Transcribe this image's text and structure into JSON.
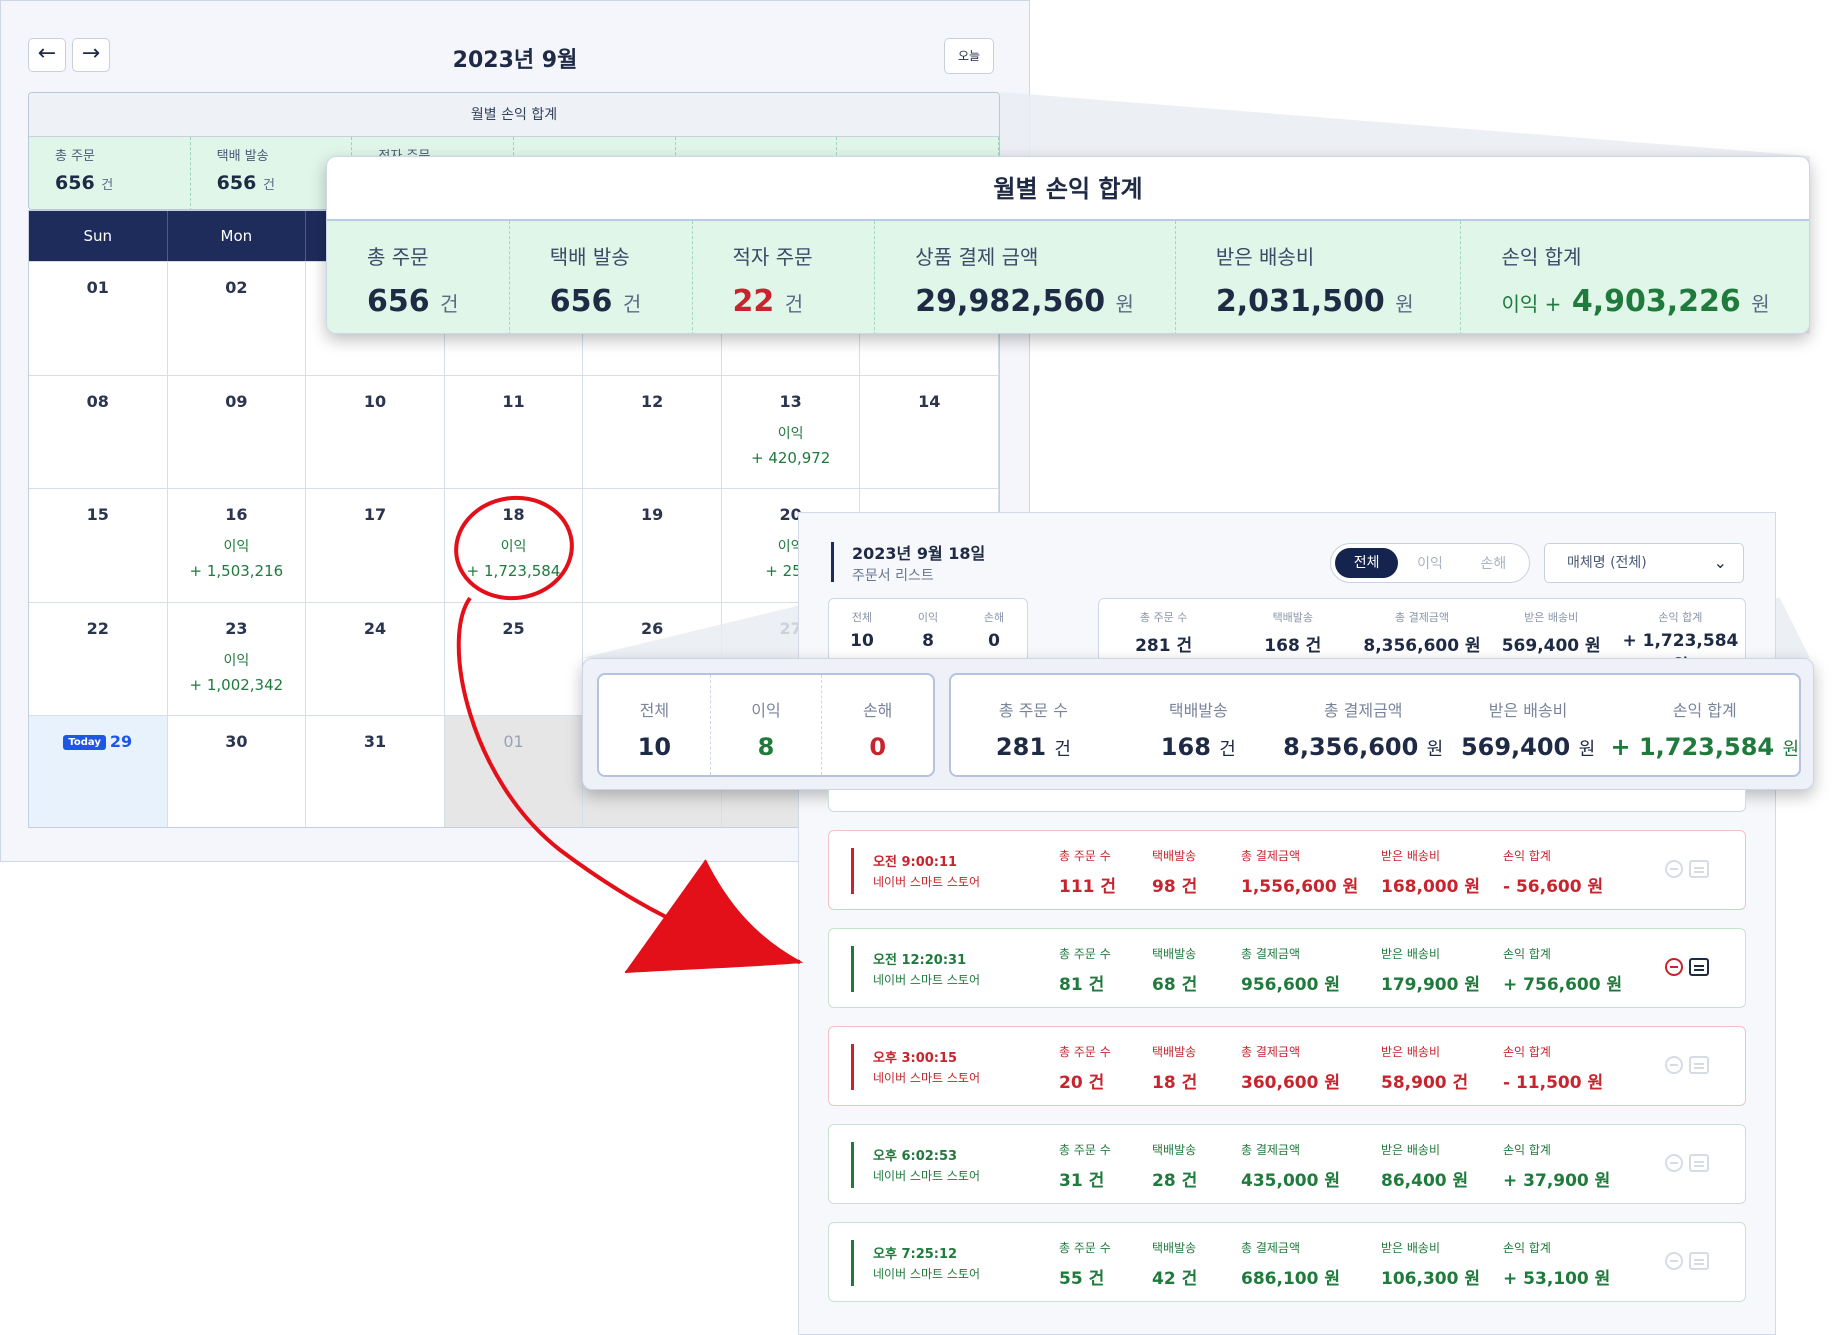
{
  "calendar": {
    "title": "2023년 9월",
    "prev_icon": "arrow-left-icon",
    "next_icon": "arrow-right-icon",
    "today_label": "오늘",
    "summary_title": "월별 손익 합계",
    "summary_preview": [
      {
        "label": "총 주문",
        "value": "656",
        "unit": "건"
      },
      {
        "label": "택배 발송",
        "value": "656",
        "unit": "건"
      },
      {
        "label": "적자 주문",
        "value": "22",
        "unit": ""
      },
      {
        "label": "",
        "value": "",
        "unit": ""
      },
      {
        "label": "",
        "value": "",
        "unit": ""
      },
      {
        "label": "",
        "value": "",
        "unit": ""
      }
    ],
    "weekdays": [
      "Sun",
      "Mon",
      "Tue",
      "Wed",
      "Thu",
      "Fri",
      "Sat"
    ],
    "today_badge": "Today",
    "weeks": [
      [
        {
          "d": "01",
          "l": "",
          "v": ""
        },
        {
          "d": "02",
          "l": "",
          "v": ""
        },
        {
          "d": "",
          "l": "",
          "v": ""
        },
        {
          "d": "",
          "l": "",
          "v": ""
        },
        {
          "d": "",
          "l": "",
          "v": ""
        },
        {
          "d": "",
          "l": "",
          "v": ""
        },
        {
          "d": "",
          "l": "",
          "v": ""
        }
      ],
      [
        {
          "d": "08",
          "l": "",
          "v": ""
        },
        {
          "d": "09",
          "l": "",
          "v": ""
        },
        {
          "d": "10",
          "l": "",
          "v": ""
        },
        {
          "d": "11",
          "l": "",
          "v": ""
        },
        {
          "d": "12",
          "l": "",
          "v": ""
        },
        {
          "d": "13",
          "l": "이익",
          "v": "+ 420,972"
        },
        {
          "d": "14",
          "l": "",
          "v": ""
        }
      ],
      [
        {
          "d": "15",
          "l": "",
          "v": ""
        },
        {
          "d": "16",
          "l": "이익",
          "v": "+ 1,503,216"
        },
        {
          "d": "17",
          "l": "",
          "v": ""
        },
        {
          "d": "18",
          "l": "이익",
          "v": "+ 1,723,584"
        },
        {
          "d": "19",
          "l": "",
          "v": ""
        },
        {
          "d": "20",
          "l": "이익",
          "v": "+ 253,"
        },
        {
          "d": "",
          "l": "",
          "v": ""
        }
      ],
      [
        {
          "d": "22",
          "l": "",
          "v": ""
        },
        {
          "d": "23",
          "l": "이익",
          "v": "+ 1,002,342"
        },
        {
          "d": "24",
          "l": "",
          "v": ""
        },
        {
          "d": "25",
          "l": "",
          "v": ""
        },
        {
          "d": "26",
          "l": "",
          "v": ""
        },
        {
          "d": "27",
          "l": "",
          "v": ""
        },
        {
          "d": "",
          "l": "",
          "v": ""
        }
      ],
      [
        {
          "d": "29",
          "l": "",
          "v": ""
        },
        {
          "d": "30",
          "l": "",
          "v": ""
        },
        {
          "d": "31",
          "l": "",
          "v": ""
        },
        {
          "d": "01",
          "l": "",
          "v": ""
        },
        {
          "d": "",
          "l": "",
          "v": ""
        },
        {
          "d": "",
          "l": "",
          "v": ""
        },
        {
          "d": "",
          "l": "",
          "v": ""
        }
      ]
    ]
  },
  "monthly_zoom": {
    "title": "월별 손익 합계",
    "cells": [
      {
        "label": "총 주문",
        "value": "656",
        "unit": "건",
        "prefix": ""
      },
      {
        "label": "택배 발송",
        "value": "656",
        "unit": "건",
        "prefix": ""
      },
      {
        "label": "적자 주문",
        "value": "22",
        "unit": "건",
        "prefix": ""
      },
      {
        "label": "상품 결제 금액",
        "value": "29,982,560",
        "unit": "원",
        "prefix": ""
      },
      {
        "label": "받은 배송비",
        "value": "2,031,500",
        "unit": "원",
        "prefix": ""
      },
      {
        "label": "손익 합계",
        "value": "4,903,226",
        "unit": "원",
        "prefix": "이익 +"
      }
    ]
  },
  "day_panel": {
    "title": "2023년 9월 18일",
    "subtitle": "주문서 리스트",
    "filters": [
      "전체",
      "이익",
      "손해"
    ],
    "store_select": "매체명 (전체)",
    "mini_left": [
      {
        "label": "전체",
        "value": "10"
      },
      {
        "label": "이익",
        "value": "8"
      },
      {
        "label": "손해",
        "value": "0"
      }
    ],
    "mini_right": [
      {
        "label": "총 주문 수",
        "value": "281 건"
      },
      {
        "label": "택배발송",
        "value": "168 건"
      },
      {
        "label": "총 결제금액",
        "value": "8,356,600 원"
      },
      {
        "label": "받은 배송비",
        "value": "569,400 원"
      },
      {
        "label": "손익 합계",
        "value": "+ 1,723,584 원"
      }
    ]
  },
  "day_zoom": {
    "left": [
      {
        "label": "전체",
        "value": "10",
        "color": "#1f2a44"
      },
      {
        "label": "이익",
        "value": "8",
        "color": "#1f7a3c"
      },
      {
        "label": "손해",
        "value": "0",
        "color": "#c8242e"
      }
    ],
    "right": [
      {
        "label": "총 주문 수",
        "value": "281",
        "unit": "건",
        "color": "#1f2a44"
      },
      {
        "label": "택배발송",
        "value": "168",
        "unit": "건",
        "color": "#1f2a44"
      },
      {
        "label": "총 결제금액",
        "value": "8,356,600",
        "unit": "원",
        "color": "#1f2a44"
      },
      {
        "label": "받은 배송비",
        "value": "569,400",
        "unit": "원",
        "color": "#1f2a44"
      },
      {
        "label": "손익 합계",
        "value": "+ 1,723,584",
        "unit": "원",
        "color": "#1f7a3c"
      }
    ]
  },
  "order_labels": [
    "총 주문 수",
    "택배발송",
    "총 결제금액",
    "받은 배송비",
    "손익 합계"
  ],
  "orders": [
    {
      "time": "오전 9:00:11",
      "store": "네이버 스마트 스토어",
      "orders": "111 건",
      "shipped": "98 건",
      "payment": "1,556,600 원",
      "shipping_fee": "168,000 원",
      "profit": "- 56,600 원",
      "type": "loss",
      "active": false
    },
    {
      "time": "오전 12:20:31",
      "store": "네이버 스마트 스토어",
      "orders": "81 건",
      "shipped": "68 건",
      "payment": "956,600 원",
      "shipping_fee": "179,900 원",
      "profit": "+ 756,600 원",
      "type": "profit",
      "active": true
    },
    {
      "time": "오후 3:00:15",
      "store": "네이버 스마트 스토어",
      "orders": "20 건",
      "shipped": "18 건",
      "payment": "360,600 원",
      "shipping_fee": "58,900 건",
      "profit": "- 11,500 원",
      "type": "loss",
      "active": false
    },
    {
      "time": "오후 6:02:53",
      "store": "네이버 스마트 스토어",
      "orders": "31 건",
      "shipped": "28 건",
      "payment": "435,000 원",
      "shipping_fee": "86,400 원",
      "profit": "+ 37,900 원",
      "type": "profit",
      "active": false
    },
    {
      "time": "오후 7:25:12",
      "store": "네이버 스마트 스토어",
      "orders": "55 건",
      "shipped": "42 건",
      "payment": "686,100 원",
      "shipping_fee": "106,300 원",
      "profit": "+ 53,100 원",
      "type": "profit",
      "active": false
    }
  ],
  "colors": {
    "navy": "#1e2c5c",
    "profit": "#1f7a3c",
    "loss": "#c8242e",
    "summary_bg": "#dff6e9",
    "annotation": "#e3101a"
  }
}
